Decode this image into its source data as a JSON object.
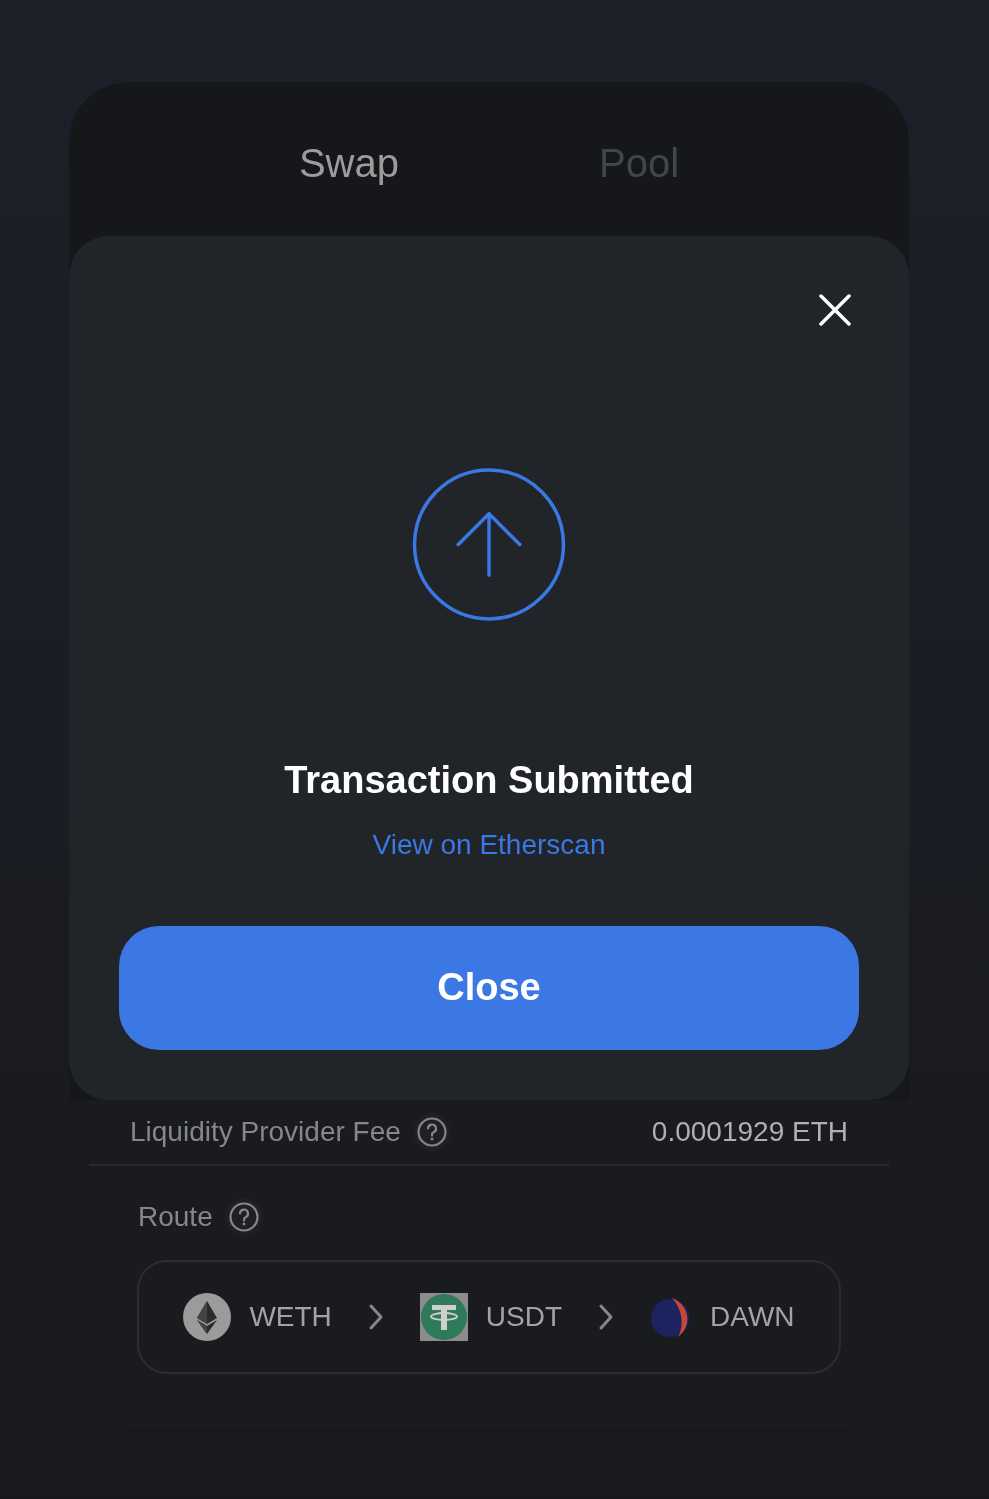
{
  "tabs": [
    {
      "label": "Swap",
      "selected": true
    },
    {
      "label": "Pool",
      "selected": false
    }
  ],
  "dialog": {
    "title": "Transaction Submitted",
    "link": "View on Etherscan",
    "button": "Close"
  },
  "details": {
    "rows": [
      {
        "label": "Liquidity Provider Fee",
        "value": "0.0001929 ETH"
      }
    ],
    "route": {
      "label": "Route",
      "tokens": [
        {
          "symbol": "WETH",
          "kind": "diamond"
        },
        {
          "symbol": "USDT",
          "kind": "tee"
        },
        {
          "symbol": "DAWN",
          "kind": "flame"
        }
      ]
    }
  }
}
